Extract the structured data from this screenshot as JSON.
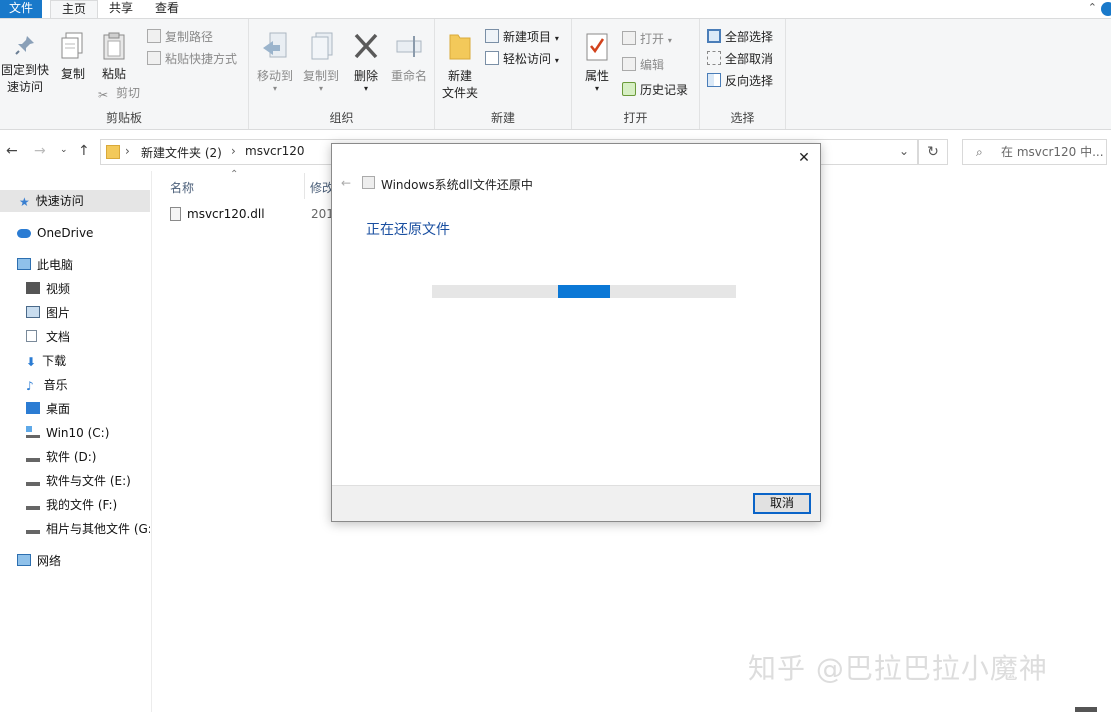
{
  "tabs": {
    "file": "文件",
    "home": "主页",
    "share": "共享",
    "view": "查看"
  },
  "ribbon": {
    "clipboard": {
      "label": "剪贴板",
      "pin_line1": "固定到快",
      "pin_line2": "速访问",
      "copy": "复制",
      "paste": "粘贴",
      "copy_path": "复制路径",
      "paste_shortcut": "粘贴快捷方式",
      "cut": "剪切"
    },
    "organize": {
      "label": "组织",
      "move_to": "移动到",
      "copy_to": "复制到",
      "delete": "删除",
      "rename": "重命名"
    },
    "new": {
      "label": "新建",
      "new_folder_line1": "新建",
      "new_folder_line2": "文件夹",
      "new_item": "新建项目",
      "easy_access": "轻松访问"
    },
    "open": {
      "label": "打开",
      "properties": "属性",
      "open": "打开",
      "edit": "编辑",
      "history": "历史记录"
    },
    "select": {
      "label": "选择",
      "select_all": "全部选择",
      "select_none": "全部取消",
      "invert": "反向选择"
    }
  },
  "address": {
    "crumb1": "新建文件夹 (2)",
    "crumb2": "msvcr120",
    "search_placeholder": "在 msvcr120 中..."
  },
  "nav": {
    "quick_access": "快速访问",
    "onedrive": "OneDrive",
    "this_pc": "此电脑",
    "videos": "视频",
    "pictures": "图片",
    "documents": "文档",
    "downloads": "下载",
    "music": "音乐",
    "desktop": "桌面",
    "drive_c": "Win10 (C:)",
    "drive_d": "软件 (D:)",
    "drive_e": "软件与文件 (E:)",
    "drive_f": "我的文件 (F:)",
    "drive_g": "相片与其他文件 (G:",
    "network": "网络"
  },
  "filelist": {
    "col_name": "名称",
    "col_modified": "修改",
    "file_name": "msvcr120.dll",
    "file_date": "201"
  },
  "dialog": {
    "title": "Windows系统dll文件还原中",
    "heading": "正在还原文件",
    "cancel": "取消",
    "progress_fraction": 0.17
  },
  "watermark": "知乎 @巴拉巴拉小魔神",
  "colors": {
    "accent": "#0b78d6",
    "file_tab": "#1979ca",
    "heading": "#1a4fa0"
  }
}
